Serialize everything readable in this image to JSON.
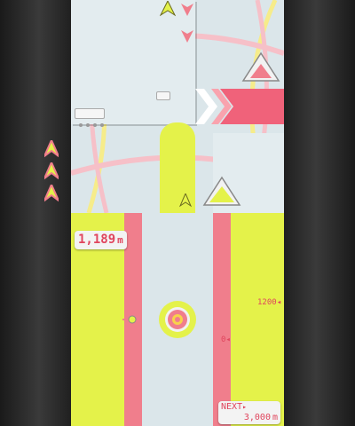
{
  "hud": {
    "distance": "1,189",
    "distance_unit": "m",
    "next_label": "NEXT",
    "next_distance": "3,000",
    "next_unit": "m"
  },
  "track_markers": [
    {
      "label": "1200"
    },
    {
      "label": "0"
    }
  ],
  "lives": {
    "count": 3
  },
  "colors": {
    "background": "#dbe6ea",
    "lime": "#e4f24a",
    "pink": "#f07e8c",
    "bezel": "#2e2e2e"
  },
  "icons": [
    "player-ship-icon",
    "enemy-arrow-icon",
    "triangle-gauge-icon",
    "target-ring-icon",
    "life-ship-icon"
  ]
}
